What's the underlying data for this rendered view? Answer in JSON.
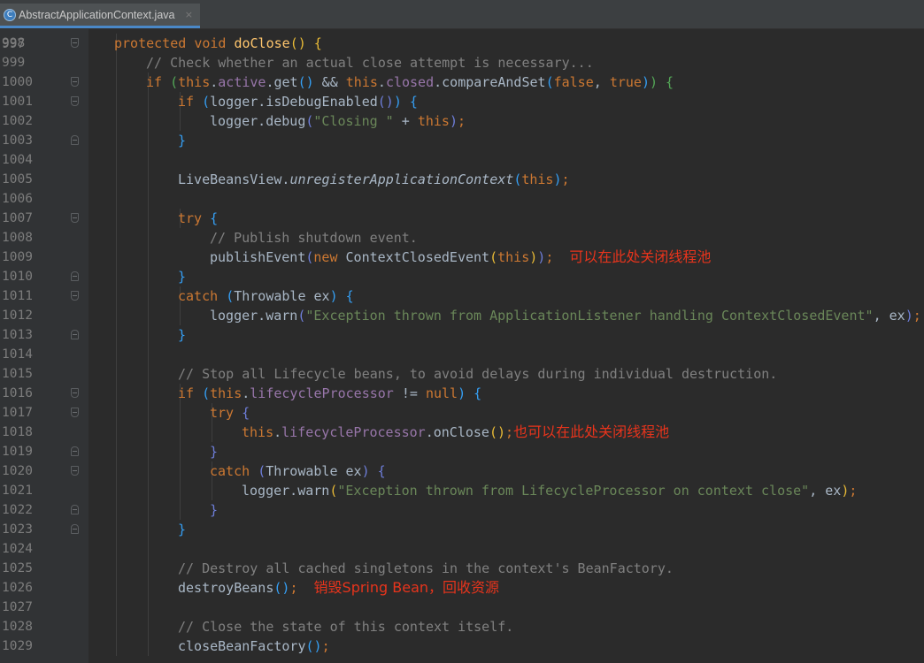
{
  "tab": {
    "icon_name": "java-class-c-icon",
    "icon_glyph": "C",
    "filename": "AbstractApplicationContext.java",
    "close_glyph": "×"
  },
  "editor": {
    "language": "Java",
    "previous_line_number": "997",
    "lines": [
      {
        "n": "998",
        "fold": "open",
        "indent": 4,
        "tokens": [
          [
            "k",
            "protected "
          ],
          [
            "k",
            "void "
          ],
          [
            "f",
            "doClose"
          ],
          [
            "b1",
            "()"
          ],
          [
            "p",
            " "
          ],
          [
            "b1",
            "{"
          ]
        ]
      },
      {
        "n": "999",
        "fold": "",
        "indent": 8,
        "tokens": [
          [
            "c",
            "// Check whether an actual close attempt is necessary..."
          ]
        ]
      },
      {
        "n": "1000",
        "fold": "open",
        "indent": 8,
        "tokens": [
          [
            "k",
            "if "
          ],
          [
            "b2",
            "("
          ],
          [
            "k",
            "this"
          ],
          [
            "p",
            "."
          ],
          [
            "v",
            "active"
          ],
          [
            "p",
            "."
          ],
          [
            "p",
            "get"
          ],
          [
            "b3",
            "()"
          ],
          [
            "p",
            " && "
          ],
          [
            "k",
            "this"
          ],
          [
            "p",
            "."
          ],
          [
            "v",
            "closed"
          ],
          [
            "p",
            "."
          ],
          [
            "p",
            "compareAndSet"
          ],
          [
            "b3",
            "("
          ],
          [
            "k",
            "false"
          ],
          [
            "p",
            ", "
          ],
          [
            "k",
            "true"
          ],
          [
            "b3",
            ")"
          ],
          [
            "b2",
            ")"
          ],
          [
            "p",
            " "
          ],
          [
            "b2",
            "{"
          ]
        ]
      },
      {
        "n": "1001",
        "fold": "open",
        "indent": 12,
        "tokens": [
          [
            "k",
            "if "
          ],
          [
            "b3",
            "("
          ],
          [
            "p",
            "logger.isDebugEnabled"
          ],
          [
            "b4",
            "()"
          ],
          [
            "b3",
            ")"
          ],
          [
            "p",
            " "
          ],
          [
            "b3",
            "{"
          ]
        ]
      },
      {
        "n": "1002",
        "fold": "",
        "indent": 16,
        "tokens": [
          [
            "p",
            "logger.debug"
          ],
          [
            "b4",
            "("
          ],
          [
            "s",
            "\"Closing \""
          ],
          [
            "p",
            " + "
          ],
          [
            "k",
            "this"
          ],
          [
            "b4",
            ")"
          ],
          [
            "k",
            ";"
          ]
        ]
      },
      {
        "n": "1003",
        "fold": "close",
        "indent": 12,
        "tokens": [
          [
            "b3",
            "}"
          ]
        ]
      },
      {
        "n": "1004",
        "fold": "",
        "indent": 0,
        "tokens": []
      },
      {
        "n": "1005",
        "fold": "",
        "indent": 12,
        "tokens": [
          [
            "p",
            "LiveBeansView."
          ],
          [
            "i",
            "unregisterApplicationContext"
          ],
          [
            "b3",
            "("
          ],
          [
            "k",
            "this"
          ],
          [
            "b3",
            ")"
          ],
          [
            "k",
            ";"
          ]
        ]
      },
      {
        "n": "1006",
        "fold": "",
        "indent": 0,
        "tokens": []
      },
      {
        "n": "1007",
        "fold": "open",
        "indent": 12,
        "tokens": [
          [
            "k",
            "try "
          ],
          [
            "b3",
            "{"
          ]
        ]
      },
      {
        "n": "1008",
        "fold": "",
        "indent": 16,
        "tokens": [
          [
            "c",
            "// Publish shutdown event."
          ]
        ]
      },
      {
        "n": "1009",
        "fold": "",
        "indent": 16,
        "tokens": [
          [
            "p",
            "publishEvent"
          ],
          [
            "b4",
            "("
          ],
          [
            "k",
            "new "
          ],
          [
            "p",
            "ContextClosedEvent"
          ],
          [
            "b1",
            "("
          ],
          [
            "k",
            "this"
          ],
          [
            "b1",
            ")"
          ],
          [
            "b4",
            ")"
          ],
          [
            "k",
            ";"
          ],
          [
            "p",
            "  "
          ]
        ],
        "note": "可以在此处关闭线程池"
      },
      {
        "n": "1010",
        "fold": "close",
        "indent": 12,
        "tokens": [
          [
            "b3",
            "}"
          ]
        ]
      },
      {
        "n": "1011",
        "fold": "open",
        "indent": 12,
        "tokens": [
          [
            "k",
            "catch "
          ],
          [
            "b3",
            "("
          ],
          [
            "p",
            "Throwable ex"
          ],
          [
            "b3",
            ")"
          ],
          [
            "p",
            " "
          ],
          [
            "b3",
            "{"
          ]
        ]
      },
      {
        "n": "1012",
        "fold": "",
        "indent": 16,
        "tokens": [
          [
            "p",
            "logger.warn"
          ],
          [
            "b4",
            "("
          ],
          [
            "s",
            "\"Exception thrown from ApplicationListener handling ContextClosedEvent\""
          ],
          [
            "p",
            ", ex"
          ],
          [
            "b4",
            ")"
          ],
          [
            "k",
            ";"
          ]
        ]
      },
      {
        "n": "1013",
        "fold": "close",
        "indent": 12,
        "tokens": [
          [
            "b3",
            "}"
          ]
        ]
      },
      {
        "n": "1014",
        "fold": "",
        "indent": 0,
        "tokens": []
      },
      {
        "n": "1015",
        "fold": "",
        "indent": 12,
        "tokens": [
          [
            "c",
            "// Stop all Lifecycle beans, to avoid delays during individual destruction."
          ]
        ]
      },
      {
        "n": "1016",
        "fold": "open",
        "indent": 12,
        "tokens": [
          [
            "k",
            "if "
          ],
          [
            "b3",
            "("
          ],
          [
            "k",
            "this"
          ],
          [
            "p",
            "."
          ],
          [
            "v",
            "lifecycleProcessor"
          ],
          [
            "p",
            " != "
          ],
          [
            "k",
            "null"
          ],
          [
            "b3",
            ")"
          ],
          [
            "p",
            " "
          ],
          [
            "b3",
            "{"
          ]
        ]
      },
      {
        "n": "1017",
        "fold": "open",
        "indent": 16,
        "tokens": [
          [
            "k",
            "try "
          ],
          [
            "b4",
            "{"
          ]
        ]
      },
      {
        "n": "1018",
        "fold": "",
        "indent": 20,
        "tokens": [
          [
            "k",
            "this"
          ],
          [
            "p",
            "."
          ],
          [
            "v",
            "lifecycleProcessor"
          ],
          [
            "p",
            "."
          ],
          [
            "p",
            "onClose"
          ],
          [
            "b1",
            "()"
          ],
          [
            "k",
            ";"
          ]
        ],
        "note": "也可以在此处关闭线程池"
      },
      {
        "n": "1019",
        "fold": "close",
        "indent": 16,
        "tokens": [
          [
            "b4",
            "}"
          ]
        ]
      },
      {
        "n": "1020",
        "fold": "open",
        "indent": 16,
        "tokens": [
          [
            "k",
            "catch "
          ],
          [
            "b4",
            "("
          ],
          [
            "p",
            "Throwable ex"
          ],
          [
            "b4",
            ")"
          ],
          [
            "p",
            " "
          ],
          [
            "b4",
            "{"
          ]
        ]
      },
      {
        "n": "1021",
        "fold": "",
        "indent": 20,
        "tokens": [
          [
            "p",
            "logger.warn"
          ],
          [
            "b1",
            "("
          ],
          [
            "s",
            "\"Exception thrown from LifecycleProcessor on context close\""
          ],
          [
            "p",
            ", ex"
          ],
          [
            "b1",
            ")"
          ],
          [
            "k",
            ";"
          ]
        ]
      },
      {
        "n": "1022",
        "fold": "close",
        "indent": 16,
        "tokens": [
          [
            "b4",
            "}"
          ]
        ]
      },
      {
        "n": "1023",
        "fold": "close",
        "indent": 12,
        "tokens": [
          [
            "b3",
            "}"
          ]
        ]
      },
      {
        "n": "1024",
        "fold": "",
        "indent": 0,
        "tokens": []
      },
      {
        "n": "1025",
        "fold": "",
        "indent": 12,
        "tokens": [
          [
            "c",
            "// Destroy all cached singletons in the context's BeanFactory."
          ]
        ]
      },
      {
        "n": "1026",
        "fold": "",
        "indent": 12,
        "tokens": [
          [
            "p",
            "destroyBeans"
          ],
          [
            "b3",
            "()"
          ],
          [
            "k",
            ";"
          ],
          [
            "p",
            "  "
          ]
        ],
        "note": "销毁Spring Bean，回收资源"
      },
      {
        "n": "1027",
        "fold": "",
        "indent": 0,
        "tokens": []
      },
      {
        "n": "1028",
        "fold": "",
        "indent": 12,
        "tokens": [
          [
            "c",
            "// Close the state of this context itself."
          ]
        ]
      },
      {
        "n": "1029",
        "fold": "",
        "indent": 12,
        "tokens": [
          [
            "p",
            "closeBeanFactory"
          ],
          [
            "b3",
            "()"
          ],
          [
            "k",
            ";"
          ]
        ]
      }
    ]
  }
}
